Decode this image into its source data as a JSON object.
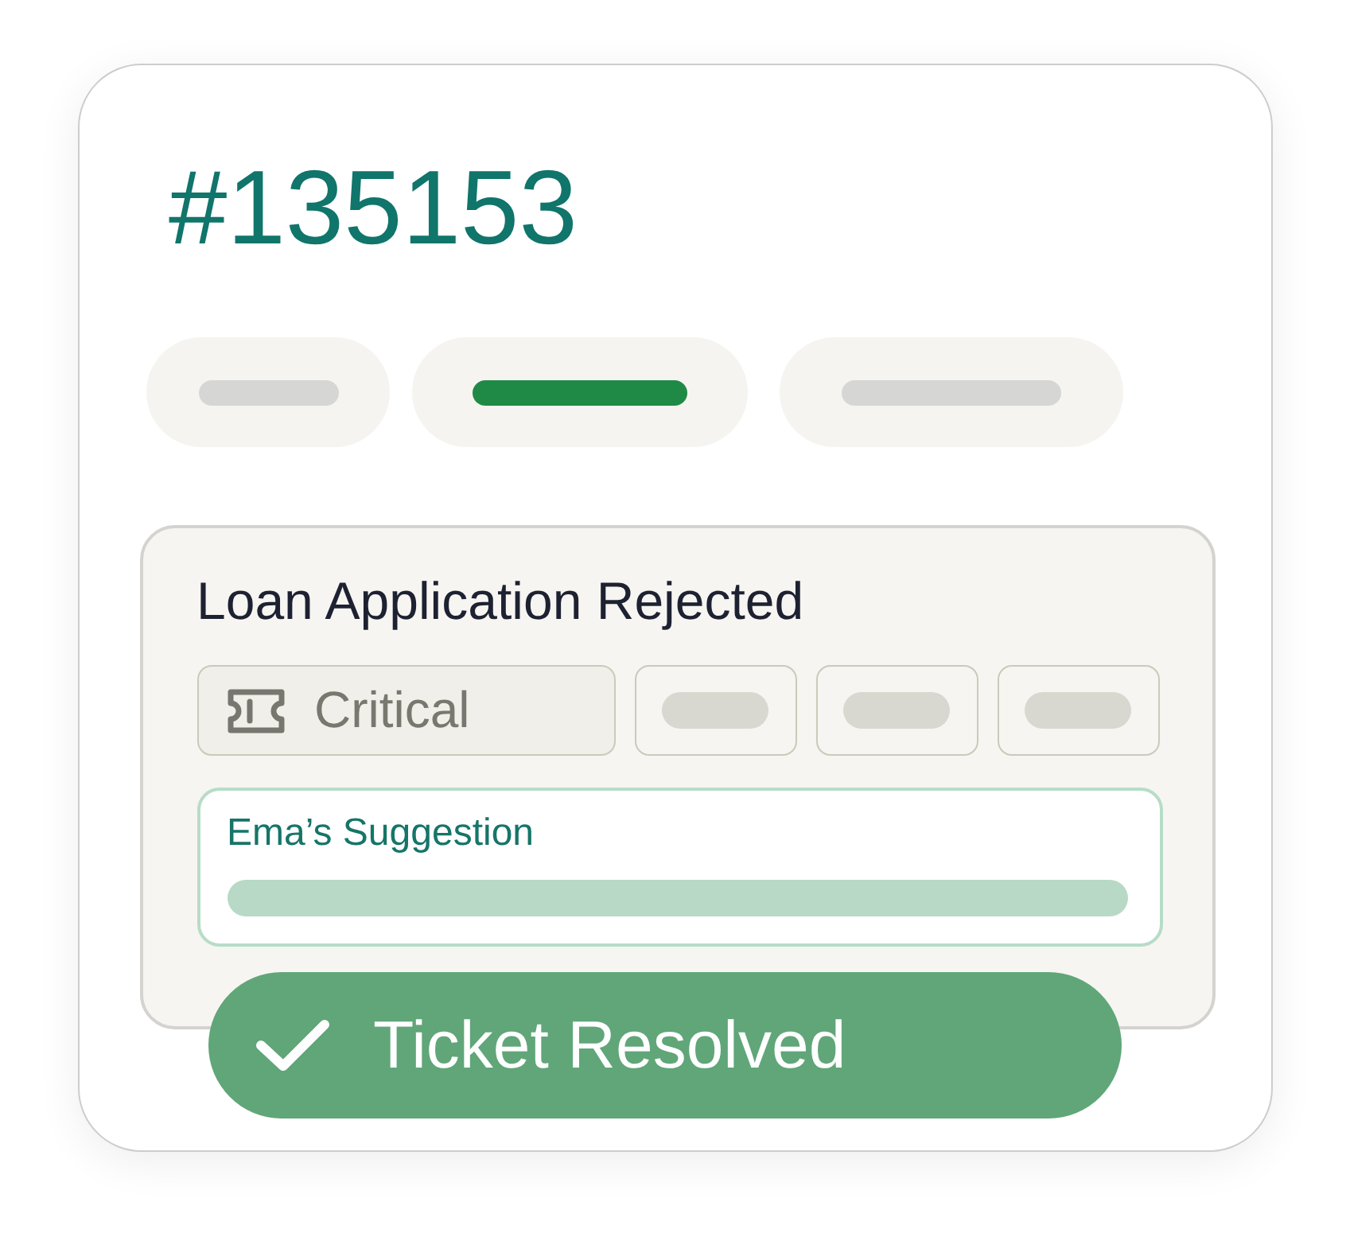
{
  "ticket": {
    "number": "#135153"
  },
  "tabs": [
    {
      "selected": false
    },
    {
      "selected": true
    },
    {
      "selected": false
    }
  ],
  "details": {
    "title": "Loan Application Rejected",
    "tags": [
      {
        "kind": "priority",
        "label": "Critical"
      },
      {
        "kind": "placeholder"
      },
      {
        "kind": "placeholder"
      },
      {
        "kind": "placeholder"
      }
    ],
    "suggestion": {
      "label": "Ema’s Suggestion"
    }
  },
  "status": {
    "label": "Ticket Resolved"
  }
}
